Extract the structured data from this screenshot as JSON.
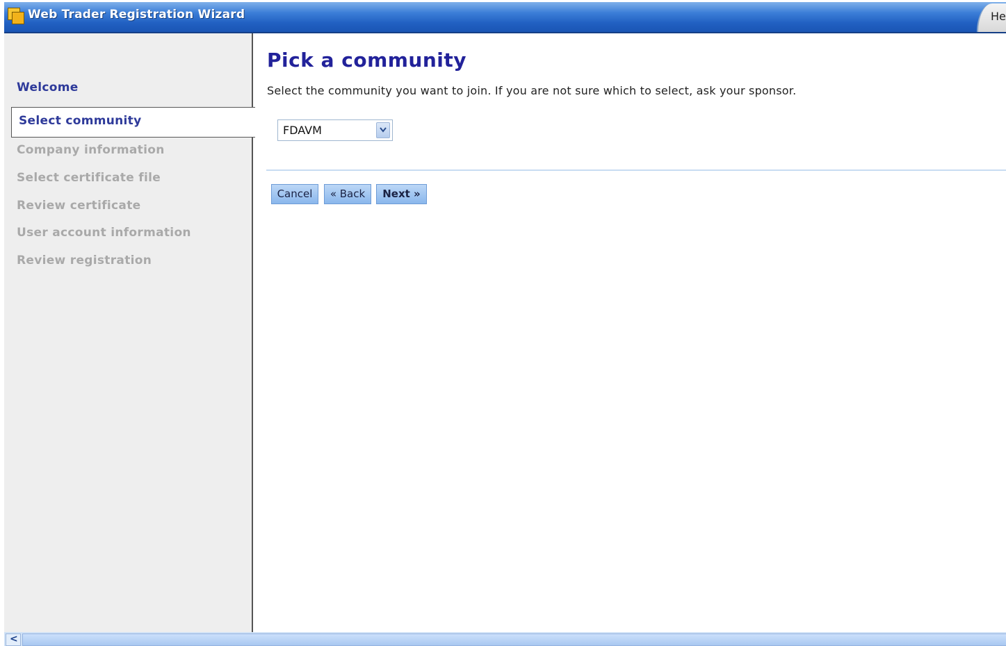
{
  "window": {
    "title": "Web Trader Registration Wizard",
    "help_label": "He"
  },
  "sidebar": {
    "items": [
      {
        "label": "Welcome",
        "state": "done"
      },
      {
        "label": "Select community",
        "state": "active"
      },
      {
        "label": "Company information",
        "state": "pending"
      },
      {
        "label": "Select certificate file",
        "state": "pending"
      },
      {
        "label": "Review certificate",
        "state": "pending"
      },
      {
        "label": "User account information",
        "state": "pending"
      },
      {
        "label": "Review registration",
        "state": "pending"
      }
    ]
  },
  "main": {
    "title": "Pick a community",
    "instructions": "Select the community you want to join. If you are not sure which to select, ask your sponsor.",
    "community_select": {
      "selected": "FDAVM"
    }
  },
  "buttons": {
    "cancel": "Cancel",
    "back": "« Back",
    "next": "Next »"
  },
  "scrollbar": {
    "left_arrow": "<"
  }
}
